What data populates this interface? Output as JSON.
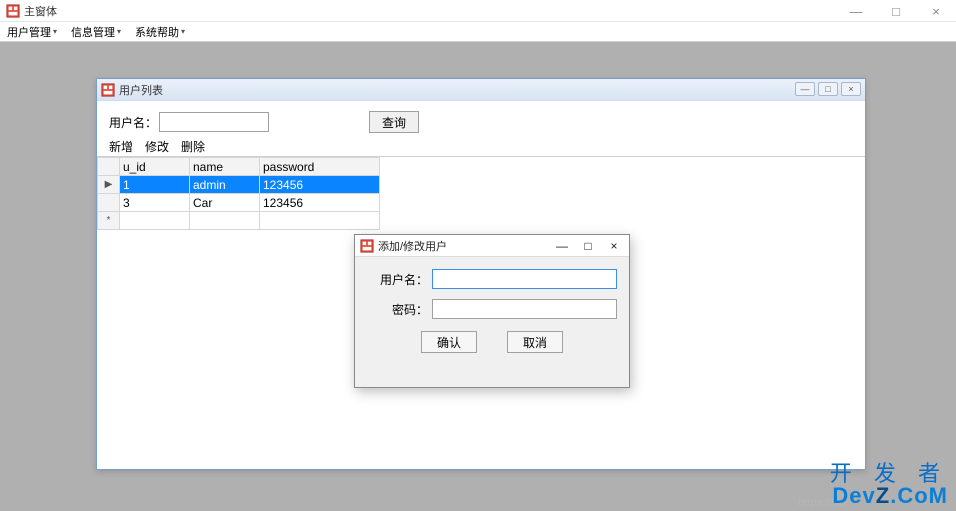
{
  "main_window": {
    "title": "主窗体"
  },
  "menubar": {
    "items": [
      "用户管理",
      "信息管理",
      "系统帮助"
    ]
  },
  "user_list_window": {
    "title": "用户列表",
    "filter": {
      "label": "用户名：",
      "value": "",
      "query_label": "查询"
    },
    "actions": {
      "add": "新增",
      "edit": "修改",
      "delete": "删除"
    },
    "columns": {
      "uid": "u_id",
      "name": "name",
      "password": "password"
    },
    "rows": [
      {
        "uid": "1",
        "name": "admin",
        "password": "123456",
        "selected": true,
        "current": true
      },
      {
        "uid": "3",
        "name": "Car",
        "password": "123456",
        "selected": false,
        "current": false
      }
    ]
  },
  "dialog": {
    "title": "添加/修改用户",
    "fields": {
      "username_label": "用户名：",
      "username_value": "",
      "password_label": "密码：",
      "password_value": ""
    },
    "buttons": {
      "ok": "确认",
      "cancel": "取消"
    }
  },
  "watermark": {
    "zh": "开 发 者",
    "en_parts": {
      "dev": "Dev",
      "z": "Z",
      "com": ".CoM"
    },
    "url_hint": "https://blo"
  },
  "icons": {
    "min": "—",
    "max": "□",
    "close": "×",
    "dropdown": "▾",
    "row_current": "▶",
    "row_new": "*"
  }
}
